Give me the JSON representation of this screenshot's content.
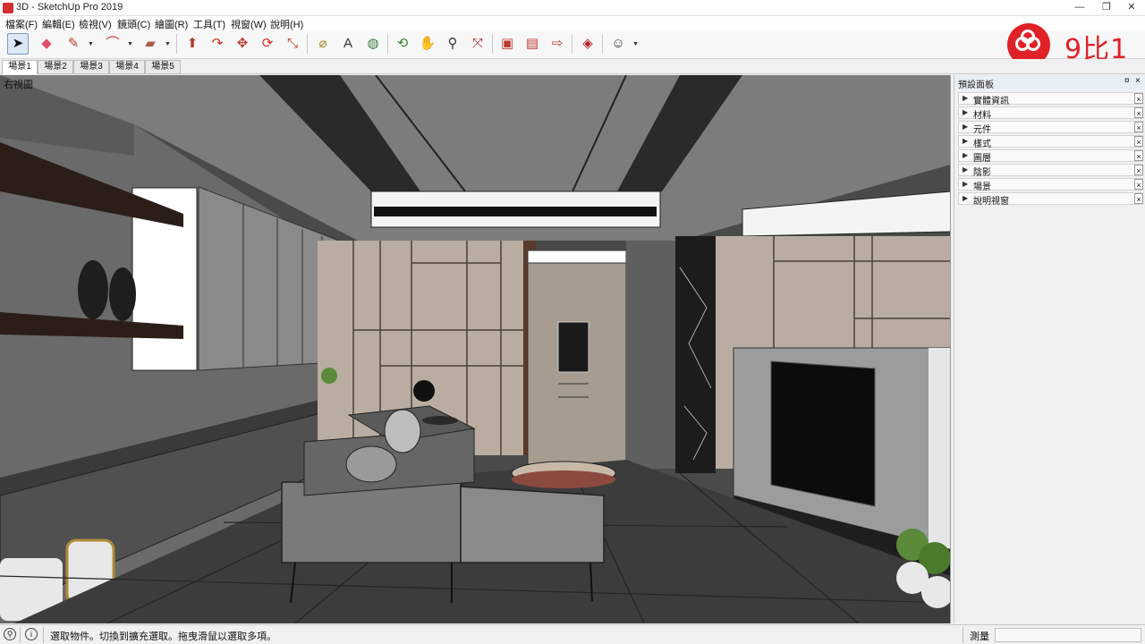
{
  "window": {
    "title": "3D - SketchUp Pro 2019",
    "controls": {
      "minimize": "—",
      "maximize": "❐",
      "close": "✕"
    }
  },
  "menu": [
    "檔案(F)",
    "編輯(E)",
    "檢視(V)",
    "鏡頭(C)",
    "繪圖(R)",
    "工具(T)",
    "視窗(W)",
    "說明(H)"
  ],
  "toolbar": {
    "tools": [
      {
        "name": "select-tool-icon",
        "glyph": "➤",
        "color": "#111111"
      },
      {
        "name": "eraser-tool-icon",
        "glyph": "◆",
        "color": "#e0506a"
      },
      {
        "name": "pencil-tool-icon",
        "glyph": "✎",
        "color": "#c0392b"
      },
      {
        "name": "arc-tool-icon",
        "glyph": "⌒",
        "color": "#c0392b"
      },
      {
        "name": "rectangle-tool-icon",
        "glyph": "▰",
        "color": "#b05a4a"
      },
      {
        "name": "push-pull-tool-icon",
        "glyph": "⬆",
        "color": "#b33a2a"
      },
      {
        "name": "follow-me-tool-icon",
        "glyph": "↷",
        "color": "#d03020"
      },
      {
        "name": "move-tool-icon",
        "glyph": "✥",
        "color": "#c0392b"
      },
      {
        "name": "rotate-tool-icon",
        "glyph": "⟳",
        "color": "#d03020"
      },
      {
        "name": "scale-tool-icon",
        "glyph": "⤡",
        "color": "#c0392b"
      },
      {
        "name": "tape-measure-tool-icon",
        "glyph": "⌀",
        "color": "#a08020"
      },
      {
        "name": "text-tool-icon",
        "glyph": "A",
        "color": "#333333"
      },
      {
        "name": "paint-bucket-tool-icon",
        "glyph": "◍",
        "color": "#3a7a3a"
      },
      {
        "name": "orbit-tool-icon",
        "glyph": "⟲",
        "color": "#2e8b2e"
      },
      {
        "name": "pan-tool-icon",
        "glyph": "✋",
        "color": "#c69a3a"
      },
      {
        "name": "zoom-tool-icon",
        "glyph": "⚲",
        "color": "#333333"
      },
      {
        "name": "zoom-extents-tool-icon",
        "glyph": "⤧",
        "color": "#b03030"
      },
      {
        "name": "warehouse-icon",
        "glyph": "▣",
        "color": "#c0392b"
      },
      {
        "name": "extension-warehouse-icon",
        "glyph": "▤",
        "color": "#c0392b"
      },
      {
        "name": "send-to-layout-icon",
        "glyph": "⇨",
        "color": "#c0392b"
      },
      {
        "name": "extension-manager-icon",
        "glyph": "◈",
        "color": "#b02020"
      },
      {
        "name": "account-icon",
        "glyph": "☺",
        "color": "#333333"
      }
    ]
  },
  "brand": {
    "logo_text": "9比1",
    "color": "#e02128"
  },
  "scenes": {
    "tabs": [
      "場景1",
      "場景2",
      "場景3",
      "場景4",
      "場景5"
    ],
    "active_index": 0
  },
  "viewport": {
    "view_label": "右視圖"
  },
  "tray": {
    "title": "預設面板",
    "pin": "¤",
    "close": "×",
    "panels": [
      "實體資訊",
      "材料",
      "元件",
      "樣式",
      "圖層",
      "陰影",
      "場景",
      "說明視窗"
    ]
  },
  "status": {
    "hint": "選取物件。切換到擴充選取。拖曳滑鼠以選取多項。",
    "measure_label": "測量",
    "measure_value": ""
  }
}
